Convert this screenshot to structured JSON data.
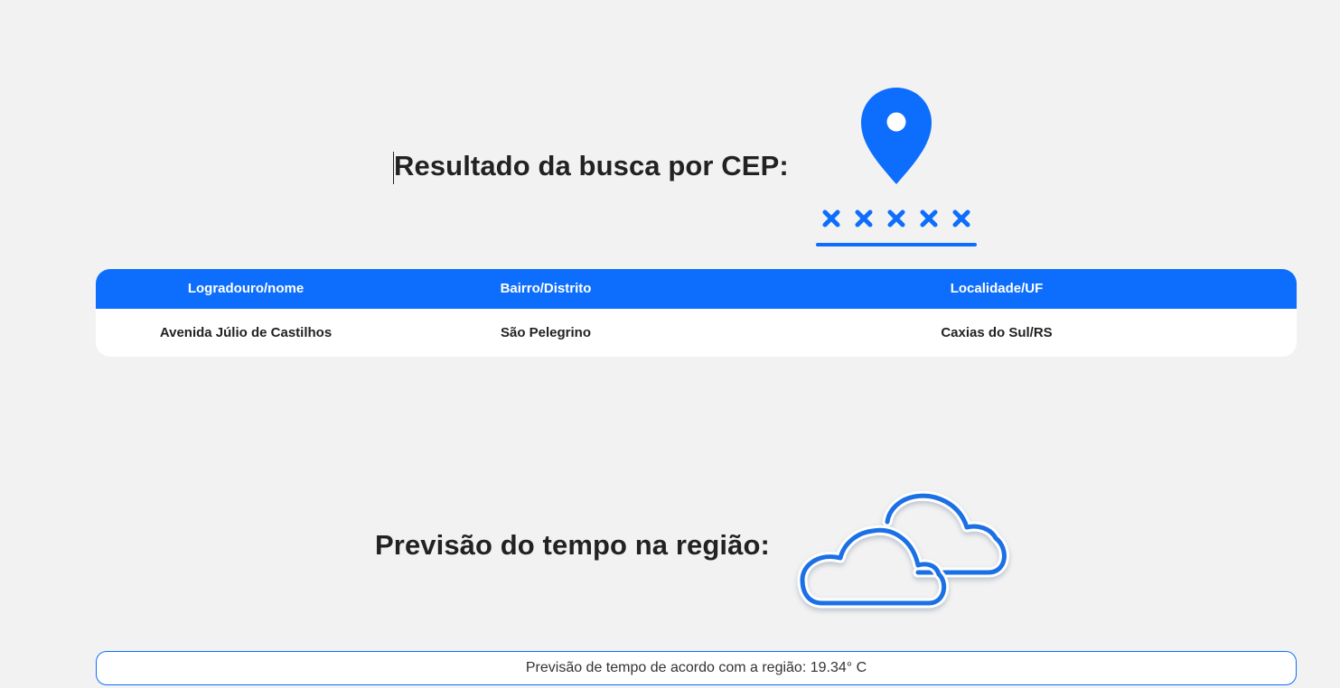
{
  "cep_section": {
    "title": "Resultado da busca por CEP:",
    "icon": "map-pin-icon",
    "masked_cep": "xxxxx"
  },
  "table": {
    "headers": [
      "Logradouro/nome",
      "Bairro/Distrito",
      "Localidade/UF"
    ],
    "rows": [
      [
        "Avenida Júlio de Castilhos",
        "São Pelegrino",
        "Caxias do Sul/RS"
      ]
    ]
  },
  "weather_section": {
    "title": "Previsão do tempo na região:",
    "icon": "cloud-icon",
    "forecast_text": "Previsão de tempo de acordo com a região: 19.34° C"
  },
  "colors": {
    "accent": "#0d6efd",
    "background": "#f2f2f2",
    "text": "#222222"
  }
}
